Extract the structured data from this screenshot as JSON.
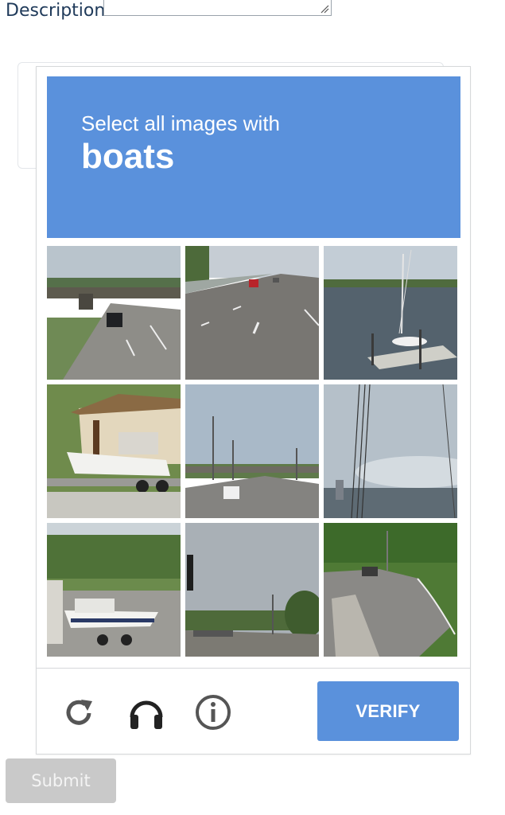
{
  "form": {
    "description_label": "Description",
    "submit_label": "Submit"
  },
  "captcha": {
    "prompt_line": "Select all images with",
    "target_word": "boats",
    "verify_label": "VERIFY",
    "accent_color": "#5a91dc",
    "controls": [
      {
        "name": "reload-icon"
      },
      {
        "name": "headphones-icon"
      },
      {
        "name": "info-icon"
      }
    ],
    "tiles": [
      {
        "scene": "highway-overpass-car"
      },
      {
        "scene": "highway-lanes-cars"
      },
      {
        "scene": "dock-sailboat"
      },
      {
        "scene": "boat-on-trailer-house"
      },
      {
        "scene": "highway-streetlights"
      },
      {
        "scene": "coastline-sky"
      },
      {
        "scene": "boat-on-trailer-trees"
      },
      {
        "scene": "traffic-light-road"
      },
      {
        "scene": "curved-road-trees"
      }
    ]
  }
}
